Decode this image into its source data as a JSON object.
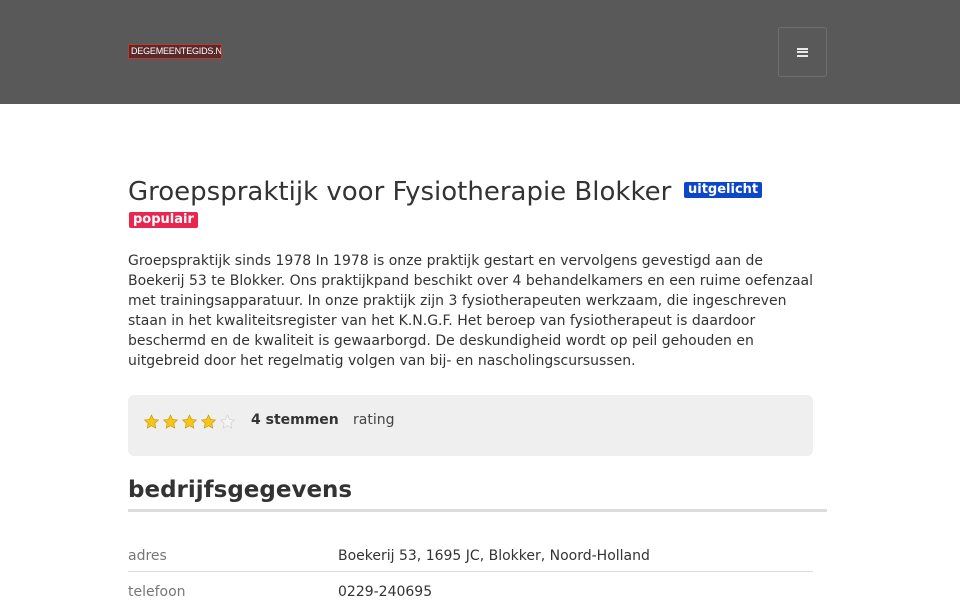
{
  "header": {
    "logo_text": "DEGEMEENTEGIDS.NL",
    "menu_icon": "hamburger-icon",
    "background_color": "#595959"
  },
  "listing": {
    "title": "Groepspraktijk voor Fysiotherapie Blokker",
    "badges": [
      {
        "label": "uitgelicht",
        "color": "#0d47c9"
      },
      {
        "label": "populair",
        "color": "#e8264f"
      }
    ],
    "description": "Groepspraktijk sinds 1978 In 1978 is onze praktijk gestart en vervolgens gevestigd aan de Boekerij 53 te Blokker. Ons praktijkpand beschikt over 4 behandelkamers en een ruime oefenzaal met trainingsapparatuur. In onze praktijk zijn 3 fysiotherapeuten werkzaam, die ingeschreven staan in het kwaliteitsregister van het K.N.G.F. Het beroep van fysiotherapeut is daardoor beschermd en de kwaliteit is gewaarborgd. De deskundigheid wordt op peil gehouden en uitgebreid door het regelmatig volgen van bij- en nascholingscursussen."
  },
  "rating": {
    "stars_filled": 4,
    "stars_total": 5,
    "votes": "4 stemmen",
    "label": "rating",
    "star_color": "#f5c518"
  },
  "company": {
    "heading": "bedrijfsgegevens",
    "rows": [
      {
        "key": "adres",
        "value": "Boekerij 53, 1695 JC, Blokker, Noord-Holland"
      },
      {
        "key": "telefoon",
        "value": "0229-240695"
      }
    ]
  }
}
